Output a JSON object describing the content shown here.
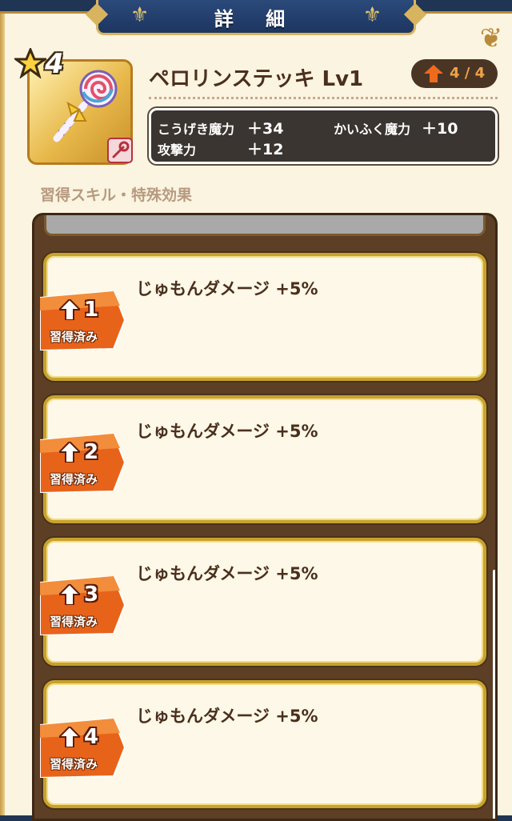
{
  "header": {
    "title": "詳 細"
  },
  "item": {
    "rarity": "4",
    "name": "ペロリンステッキ Lv1",
    "level_progress": "4 / 4"
  },
  "stats": [
    {
      "label": "こうげき魔力",
      "value": "＋34"
    },
    {
      "label": "かいふく魔力",
      "value": "＋10"
    },
    {
      "label": "攻撃力",
      "value": "＋12"
    }
  ],
  "section": {
    "label": "習得スキル・特殊効果"
  },
  "skills": [
    {
      "text": "じゅもんダメージ +5%",
      "level": "1",
      "status": "習得済み"
    },
    {
      "text": "じゅもんダメージ +5%",
      "level": "2",
      "status": "習得済み"
    },
    {
      "text": "じゅもんダメージ +5%",
      "level": "3",
      "status": "習得済み"
    },
    {
      "text": "じゅもんダメージ +5%",
      "level": "4",
      "status": "習得済み"
    }
  ],
  "colors": {
    "header_blue": "#1f3553",
    "gold": "#c8a22e",
    "panel_brown": "#5c3f24",
    "tag_orange": "#e8631a",
    "level_orange": "#f0a24a"
  }
}
